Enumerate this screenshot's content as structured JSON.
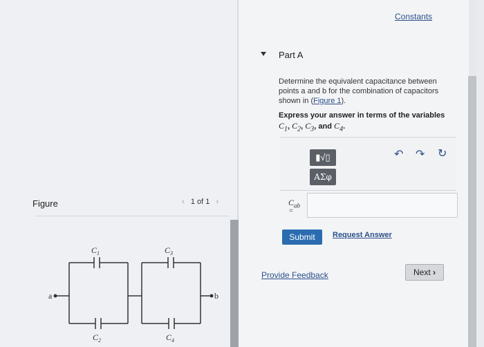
{
  "header": {
    "constants_label": "Constants"
  },
  "part": {
    "title": "Part A"
  },
  "question": {
    "prompt_before": "Determine the equivalent capacitance between points a and b for the combination of capacitors shown in (",
    "figure_link": "Figure 1",
    "prompt_after": ").",
    "express_prefix": "Express your answer in terms of the variables",
    "var1": "C1",
    "var2": "C2",
    "var3": "C3",
    "var4": "C4",
    "express_and": "and"
  },
  "toolbar": {
    "templates_label": "▮√▯",
    "symbols_label": "ΑΣφ",
    "undo_icon": "undo-icon",
    "redo_icon": "redo-icon",
    "reset_icon": "reset-icon"
  },
  "answer": {
    "label": "C",
    "label_sub": "ab",
    "equals": "=",
    "value": ""
  },
  "actions": {
    "submit": "Submit",
    "request": "Request Answer"
  },
  "footer": {
    "feedback": "Provide Feedback",
    "next": "Next"
  },
  "figure": {
    "title": "Figure",
    "page": "1 of 1",
    "labels": {
      "c1": "C1",
      "c2": "C2",
      "c3": "C3",
      "c4": "C4",
      "a": "a",
      "b": "b"
    }
  },
  "colors": {
    "link": "#2b4f8a",
    "submit": "#2b6cb0",
    "button_dark": "#5b5f66"
  }
}
